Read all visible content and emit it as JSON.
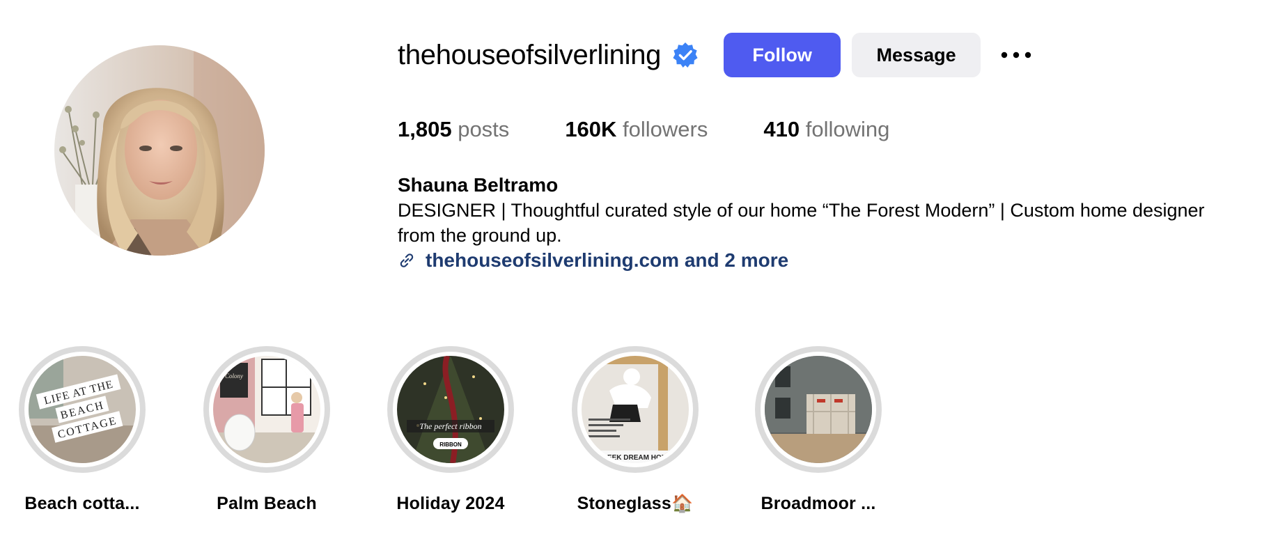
{
  "profile": {
    "username": "thehouseofsilverlining",
    "verified_icon": "verified-badge-icon",
    "follow_label": "Follow",
    "message_label": "Message",
    "more_icon": "more-options-icon"
  },
  "stats": {
    "posts_count": "1,805",
    "posts_label": "posts",
    "followers_count": "160K",
    "followers_label": "followers",
    "following_count": "410",
    "following_label": "following"
  },
  "bio": {
    "full_name": "Shauna Beltramo",
    "text": "DESIGNER | Thoughtful curated style of our home “The Forest Modern” | Custom home designer\nfrom the ground up.",
    "link_icon": "link-icon",
    "link_text": "thehouseofsilverlining.com and 2 more"
  },
  "highlights": [
    {
      "label": "Beach cotta...",
      "cover_text": [
        "LIFE AT THE",
        "BEACH",
        "COTTAGE"
      ]
    },
    {
      "label": "Palm Beach",
      "cover_text": [
        "Colony"
      ]
    },
    {
      "label": "Holiday 2024",
      "cover_text": [
        "The perfect ribbon",
        "RIBBON"
      ]
    },
    {
      "label": "Stoneglass🏠",
      "cover_text": [
        "PEEK DREAM HOME"
      ]
    },
    {
      "label": "Broadmoor ...",
      "cover_text": []
    }
  ],
  "colors": {
    "follow_button": "#4f5bf0",
    "message_button": "#efeff2",
    "verified": "#3b82f6",
    "link": "#1e3b70",
    "muted": "#737373",
    "highlight_ring": "#dbdbdb"
  }
}
